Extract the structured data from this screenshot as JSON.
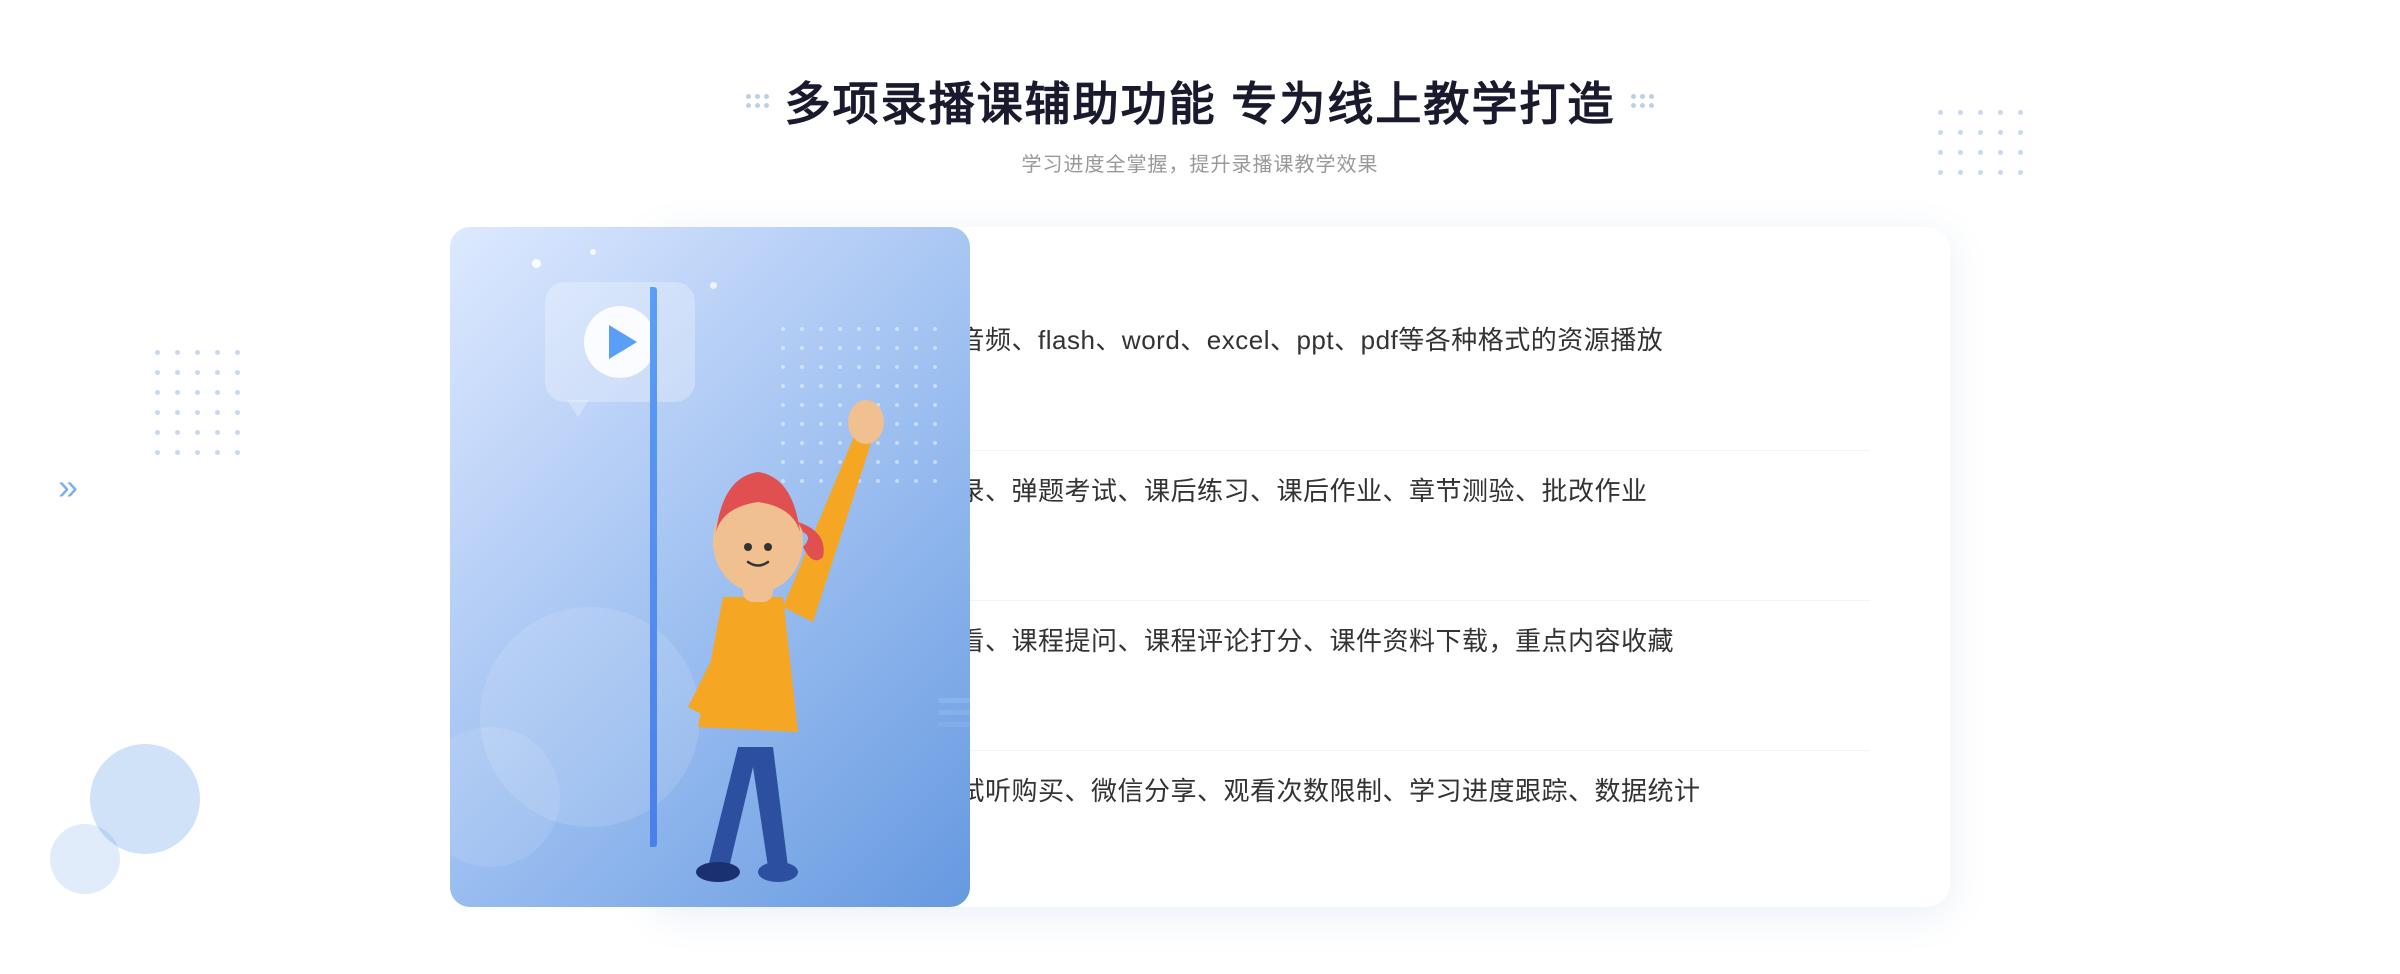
{
  "header": {
    "title": "多项录播课辅助功能 专为线上教学打造",
    "subtitle": "学习进度全掌握，提升录播课教学效果"
  },
  "features": [
    {
      "id": 1,
      "text": "支持视频、音频、flash、word、excel、ppt、pdf等各种格式的资源播放"
    },
    {
      "id": 2,
      "text": "支持章节目录、弹题考试、课后练习、课后作业、章节测验、批改作业"
    },
    {
      "id": 3,
      "text": "学习笔记回看、课程提问、课程评论打分、课件资料下载，重点内容收藏"
    },
    {
      "id": 4,
      "text": "互动弹幕、试听购买、微信分享、观看次数限制、学习进度跟踪、数据统计"
    }
  ],
  "icons": {
    "chevron_double": "»",
    "check_circle": "✓",
    "play": "▶"
  },
  "colors": {
    "accent_blue": "#4a7fe8",
    "light_blue": "#6699e0",
    "text_dark": "#1a1a2e",
    "text_gray": "#999999",
    "text_feature": "#333333"
  }
}
